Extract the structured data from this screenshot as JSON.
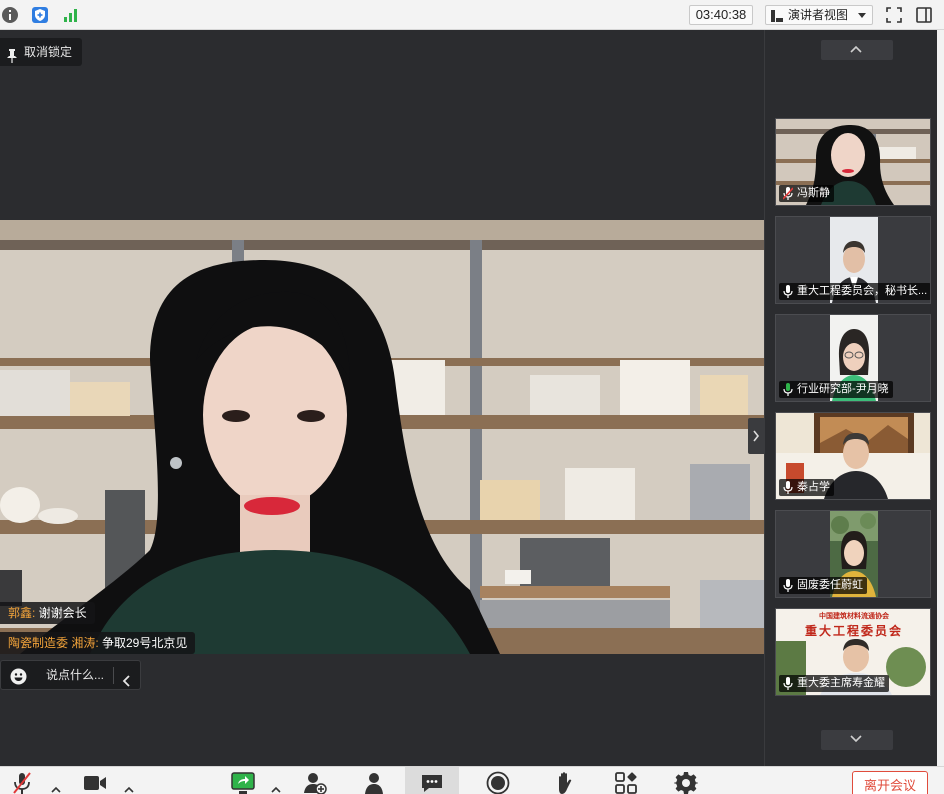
{
  "topbar": {
    "timer": "03:40:38",
    "view_label": "演讲者视图"
  },
  "stage": {
    "unlock_label": "取消锁定",
    "chat_messages": [
      {
        "sender": "郭鑫:",
        "text": " 谢谢会长"
      },
      {
        "sender": "陶瓷制造委 湘涛:",
        "text": " 争取29号北京见"
      }
    ],
    "chat_placeholder": "说点什么..."
  },
  "participants": [
    {
      "name": "冯斯静",
      "muted": true
    },
    {
      "name": "重大工程委员会，秘书长...",
      "muted": false
    },
    {
      "name": "行业研究部-尹月晓",
      "muted": false
    },
    {
      "name": "秦占学",
      "muted": false
    },
    {
      "name": "固废委任蔚虹",
      "muted": false
    },
    {
      "name": "重大委主席寿金耀",
      "muted": false
    }
  ],
  "tile_banner": {
    "line1": "中国建筑材料流通协会",
    "line2": "重大工程委员会"
  },
  "toolbar": {
    "leave_label": "离开会议"
  },
  "colors": {
    "accent_green": "#2fb34a",
    "leave_red": "#e04c3c",
    "chat_sender": "#f2a33a"
  }
}
